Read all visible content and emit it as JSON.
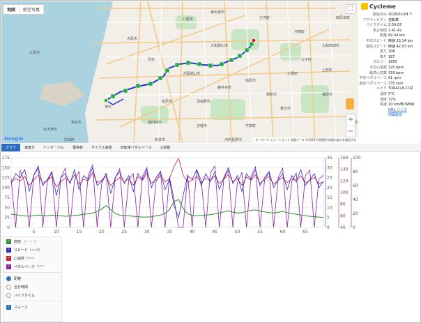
{
  "map": {
    "tabs": [
      "地図",
      "航空写真"
    ],
    "fullscreen_icon": "⛶",
    "zoom_in": "+",
    "zoom_out": "−",
    "google_logo": "Google",
    "attribution": "キーボード ショートカット  地図データ ©2025  利用規約  地図の誤りを報告する",
    "places": [
      "八尾市",
      "東大阪市",
      "大阪市",
      "堺市",
      "松原市",
      "羽曳野市",
      "藤井寺市",
      "柏原市",
      "河南町",
      "太子町",
      "大和高田市",
      "香芝市",
      "橿原市",
      "田原本町",
      "大和郡山市",
      "富田林市",
      "天理市",
      "平群町",
      "三郷町",
      "王寺町",
      "上牧町",
      "葛城市",
      "御所市",
      "高石市",
      "泉大津市",
      "忠岡町",
      "和泉市",
      "河内長野市",
      "大阪狭山市",
      "羽衣",
      "大阪湾"
    ],
    "route_color": "#2233cc",
    "marker_color": "#22aa44"
  },
  "stats": {
    "title": "Cycleme",
    "rows": [
      {
        "label": "開始済み",
        "value": "2025/01/04 7:"
      },
      {
        "label": "アクティビティ",
        "value": "自転車"
      },
      {
        "label": "バイクタイム",
        "value": "2:59:03"
      },
      {
        "label": "停止時間",
        "value": "1:41:42"
      },
      {
        "label": "距離",
        "value": "69.04 km"
      },
      {
        "label": "平均スピード",
        "value": "時速 23.14 km"
      },
      {
        "label": "最高スピード",
        "value": "時速 42.07 km"
      },
      {
        "label": "登り",
        "value": "206"
      },
      {
        "label": "降り",
        "value": "187"
      },
      {
        "label": "カロリー",
        "value": "1855"
      },
      {
        "label": "平均心拍数",
        "value": "120 bpm"
      },
      {
        "label": "最高心拍数",
        "value": "159 bpm"
      },
      {
        "label": "平均ペダルペース",
        "value": "61 rpm"
      },
      {
        "label": "最高ペダルペース",
        "value": "135 rpm"
      },
      {
        "label": "バイク",
        "value": "TORACLE-COZ"
      },
      {
        "label": "温度",
        "value": "5°C"
      },
      {
        "label": "湿度",
        "value": "72%"
      },
      {
        "label": "風速",
        "value": "10 km/時 WNW"
      }
    ],
    "kml_link": "KML リンク",
    "settings_link": "地図設定"
  },
  "chart_tabs": [
    "グラフ",
    "速度分",
    "インターバル",
    "獲得表",
    "サイクル速度",
    "自転車ペダルペース",
    "心拍数"
  ],
  "colors": {
    "elevation": "#2e8b2e",
    "speed": "#2828c8",
    "heart": "#d01e3c",
    "cadence": "#8a1ea0",
    "accent": "#2a6fbd"
  },
  "chart_data": {
    "type": "line",
    "x": {
      "range": [
        0,
        69
      ],
      "ticks": [
        5,
        10,
        15,
        20,
        25,
        30,
        35,
        40,
        45,
        50,
        55,
        60,
        65
      ]
    },
    "left_axis": {
      "range": [
        0,
        175
      ],
      "ticks": [
        0,
        25,
        50,
        75,
        100,
        125,
        150,
        175
      ]
    },
    "right_axis_1": {
      "range": [
        0,
        35
      ],
      "ticks": [
        0,
        5,
        10,
        15,
        20,
        25,
        30,
        35
      ]
    },
    "right_axis_2": {
      "range": [
        40,
        160
      ],
      "ticks": [
        40,
        60,
        80,
        100,
        120,
        140,
        160
      ]
    },
    "right_axis_3": {
      "range": [
        0,
        100
      ],
      "ticks": [
        0,
        20,
        40,
        60,
        80,
        100
      ]
    },
    "series": [
      {
        "name": "高度",
        "key": "elevation",
        "axis": "left",
        "values": [
          33,
          32,
          30,
          29,
          28,
          30,
          31,
          30,
          29,
          31,
          30,
          29,
          28,
          29,
          30,
          31,
          33,
          34,
          36,
          40,
          46,
          55,
          45,
          35,
          31,
          30,
          29,
          28,
          27,
          26,
          26,
          27,
          29,
          31,
          35,
          45,
          65,
          70,
          48,
          34,
          30,
          29,
          30,
          31,
          32,
          34,
          36,
          39,
          42,
          38,
          36,
          37,
          40,
          43,
          44,
          41,
          39,
          37,
          36,
          38,
          40,
          37,
          35,
          33,
          31,
          29,
          28,
          27,
          26,
          25
        ]
      },
      {
        "name": "スピード",
        "key": "speed",
        "axis": "right_axis_1",
        "values": [
          22,
          27,
          25,
          29,
          18,
          26,
          30,
          21,
          24,
          28,
          16,
          25,
          27,
          22,
          29,
          19,
          26,
          24,
          30,
          21,
          23,
          27,
          17,
          25,
          28,
          22,
          26,
          18,
          27,
          24,
          29,
          20,
          25,
          28,
          19,
          24,
          11,
          5,
          16,
          26,
          24,
          29,
          21,
          27,
          23,
          28,
          19,
          25,
          30,
          22,
          26,
          18,
          27,
          24,
          29,
          21,
          25,
          28,
          20,
          24,
          27,
          19,
          26,
          23,
          29,
          21,
          24,
          27,
          20,
          23
        ]
      },
      {
        "name": "心拍数",
        "key": "heart",
        "axis": "right_axis_2",
        "values": [
          118,
          124,
          120,
          128,
          112,
          122,
          130,
          116,
          121,
          127,
          110,
          119,
          125,
          118,
          131,
          114,
          123,
          120,
          134,
          117,
          121,
          128,
          112,
          120,
          126,
          119,
          124,
          113,
          127,
          121,
          133,
          116,
          122,
          129,
          118,
          124,
          145,
          159,
          130,
          118,
          121,
          128,
          117,
          125,
          120,
          129,
          115,
          123,
          131,
          119,
          124,
          113,
          127,
          121,
          130,
          116,
          122,
          128,
          114,
          121,
          126,
          117,
          124,
          120,
          129,
          116,
          121,
          126,
          115,
          119
        ]
      },
      {
        "name": "ペダルペース",
        "key": "cadence",
        "axis": "right_axis_3",
        "values": [
          70,
          0,
          82,
          64,
          0,
          75,
          88,
          0,
          66,
          79,
          0,
          72,
          85,
          0,
          68,
          80,
          0,
          74,
          90,
          0,
          63,
          78,
          0,
          71,
          84,
          0,
          69,
          77,
          0,
          73,
          86,
          0,
          65,
          81,
          0,
          72,
          40,
          0,
          0,
          76,
          0,
          83,
          67,
          0,
          78,
          88,
          0,
          70,
          82,
          0,
          64,
          79,
          0,
          73,
          87,
          0,
          68,
          80,
          0,
          71,
          85,
          0,
          66,
          78,
          0,
          74,
          82,
          0,
          69,
          75
        ]
      }
    ]
  },
  "series_panel": {
    "series": [
      {
        "label": "高度",
        "unit": "メートル",
        "key": "elevation"
      },
      {
        "label": "スピード",
        "unit": "km/時",
        "key": "speed"
      },
      {
        "label": "心拍数",
        "unit": "bpm",
        "key": "heart"
      },
      {
        "label": "ペダルペース",
        "unit": "rpm",
        "key": "cadence"
      }
    ],
    "x_options": [
      {
        "label": "距離",
        "selected": true
      },
      {
        "label": "合計時間",
        "selected": false
      },
      {
        "label": "バイクタイム",
        "selected": false
      }
    ],
    "smooth_label": "スムーズ",
    "check_icon": "✓"
  }
}
